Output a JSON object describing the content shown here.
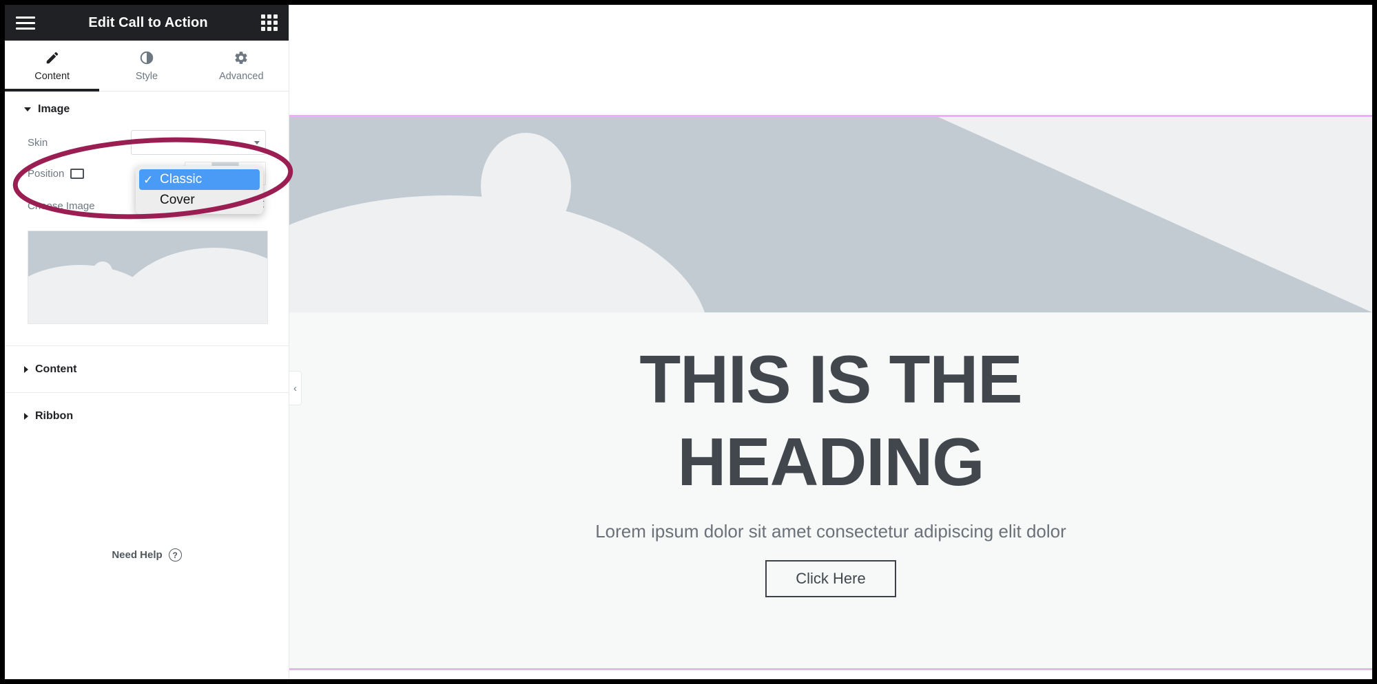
{
  "panel": {
    "header": {
      "title": "Edit Call to Action",
      "menu_icon": "hamburger-icon",
      "apps_icon": "grid-icon"
    },
    "tabs": [
      {
        "label": "Content",
        "icon": "pencil-icon",
        "active": true
      },
      {
        "label": "Style",
        "icon": "contrast-icon",
        "active": false
      },
      {
        "label": "Advanced",
        "icon": "gear-icon",
        "active": false
      }
    ],
    "sections": [
      {
        "label": "Image",
        "expanded": true
      },
      {
        "label": "Content",
        "expanded": false
      },
      {
        "label": "Ribbon",
        "expanded": false
      }
    ],
    "image_section": {
      "skin": {
        "label": "Skin",
        "value": "Classic",
        "options": [
          "Classic",
          "Cover"
        ],
        "selected_index": 0,
        "open": true,
        "checkmark": "✓"
      },
      "position": {
        "label": "Position",
        "device_icon": "desktop-monitor-icon",
        "alignments": [
          {
            "name": "align-left",
            "glyph": "|←",
            "active": false
          },
          {
            "name": "align-center",
            "glyph": "↑",
            "active": true
          },
          {
            "name": "align-right",
            "glyph": "→|",
            "active": false
          }
        ]
      },
      "choose_image": {
        "label": "Choose Image",
        "ai_icon": "sparkle-icon",
        "thumbnail_alt": "image-placeholder"
      }
    },
    "footer": {
      "need_help_label": "Need Help",
      "help_icon": "question-circle-icon"
    },
    "collapse_handle": {
      "icon": "chevron-left-icon",
      "glyph": "‹"
    }
  },
  "canvas": {
    "section": {
      "border_color": "#f4aaf7",
      "background": "#f7f8f8"
    },
    "banner": {
      "alt": "image-placeholder-banner",
      "background": "#c2cad2",
      "shape_color": "#eef0f2"
    },
    "heading": "THIS IS THE HEADING",
    "subheading": "Lorem ipsum dolor sit amet consectetur adipiscing elit dolor",
    "button_label": "Click Here"
  },
  "annotation": {
    "shape": "ellipse-highlight",
    "color": "#9b1e53",
    "target": "skin-dropdown"
  },
  "colors": {
    "panel_header_bg": "#1f2124",
    "accent_selected": "#4a9bf5",
    "annotation": "#9b1e53",
    "section_border": "#f4aaf7"
  }
}
